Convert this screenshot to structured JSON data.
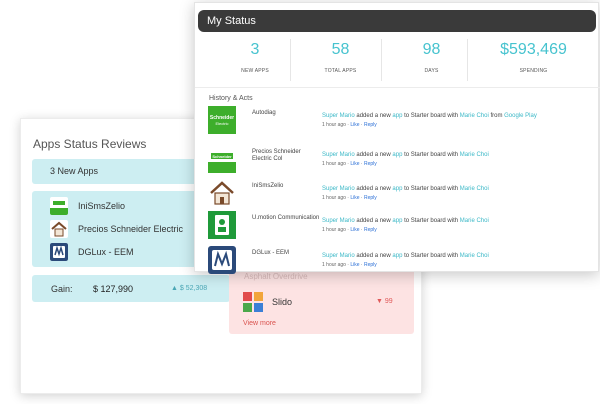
{
  "back_card": {
    "title": "Apps Status Reviews",
    "new_apps_label": "3 New Apps",
    "apps": [
      "IniSmsZelio",
      "Precios Schneider Electric",
      "DGLux - EEM"
    ],
    "gain": {
      "label": "Gain:",
      "value": "$ 127,990",
      "delta": "▲ $ 52,308"
    },
    "faded_item": "Asphalt Overdrive",
    "slido": {
      "name": "Slido",
      "delta": "▼ 99"
    },
    "view_more": "View more"
  },
  "my_status": {
    "title": "My Status",
    "stats": [
      {
        "value": "3",
        "label": "NEW APPS"
      },
      {
        "value": "58",
        "label": "TOTAL APPS"
      },
      {
        "value": "98",
        "label": "DAYS"
      },
      {
        "value": "$593,469",
        "label": "SPENDING"
      }
    ],
    "history_title": "History & Acts",
    "acts": [
      {
        "app": "Autodiag",
        "user": "Super Mario",
        "t1": " added a new ",
        "app_word": "app",
        "t2": " to Starter board with ",
        "person": "Marie Choi",
        "t3": " from ",
        "source": "Google Play",
        "time": "1 hour ago · ",
        "like": "Like",
        "sep": " · ",
        "reply": "Reply"
      },
      {
        "app": "Precios Schneider Electric Col",
        "user": "Super Mario",
        "t1": " added a new ",
        "app_word": "app",
        "t2": " to Starter board with ",
        "person": "Marie Choi",
        "t3": "",
        "source": "",
        "time": "1 hour ago · ",
        "like": "Like",
        "sep": " · ",
        "reply": "Reply"
      },
      {
        "app": "IniSmsZelio",
        "user": "Super Mario",
        "t1": " added a new ",
        "app_word": "app",
        "t2": " to Starter board with ",
        "person": "Marie Choi",
        "t3": "",
        "source": "",
        "time": "1 hour ago · ",
        "like": "Like",
        "sep": " · ",
        "reply": "Reply"
      },
      {
        "app": "U.motion Communication",
        "user": "Super Mario",
        "t1": " added a new ",
        "app_word": "app",
        "t2": " to Starter board with ",
        "person": "Marie Choi",
        "t3": "",
        "source": "",
        "time": "1 hour ago · ",
        "like": "Like",
        "sep": " · ",
        "reply": "Reply"
      },
      {
        "app": "DGLux - EEM",
        "user": "Super Mario",
        "t1": " added a new ",
        "app_word": "app",
        "t2": " to Starter board with ",
        "person": "Marie Choi",
        "t3": "",
        "source": "",
        "time": "1 hour ago · ",
        "like": "Like",
        "sep": " · ",
        "reply": "Reply"
      }
    ]
  },
  "colors": {
    "accent": "#46c3cf",
    "header": "#3a3a3a",
    "panel": "#cdeef2",
    "pink": "#fde3e3",
    "link": "#2a6fd6",
    "danger": "#e05a5a"
  }
}
